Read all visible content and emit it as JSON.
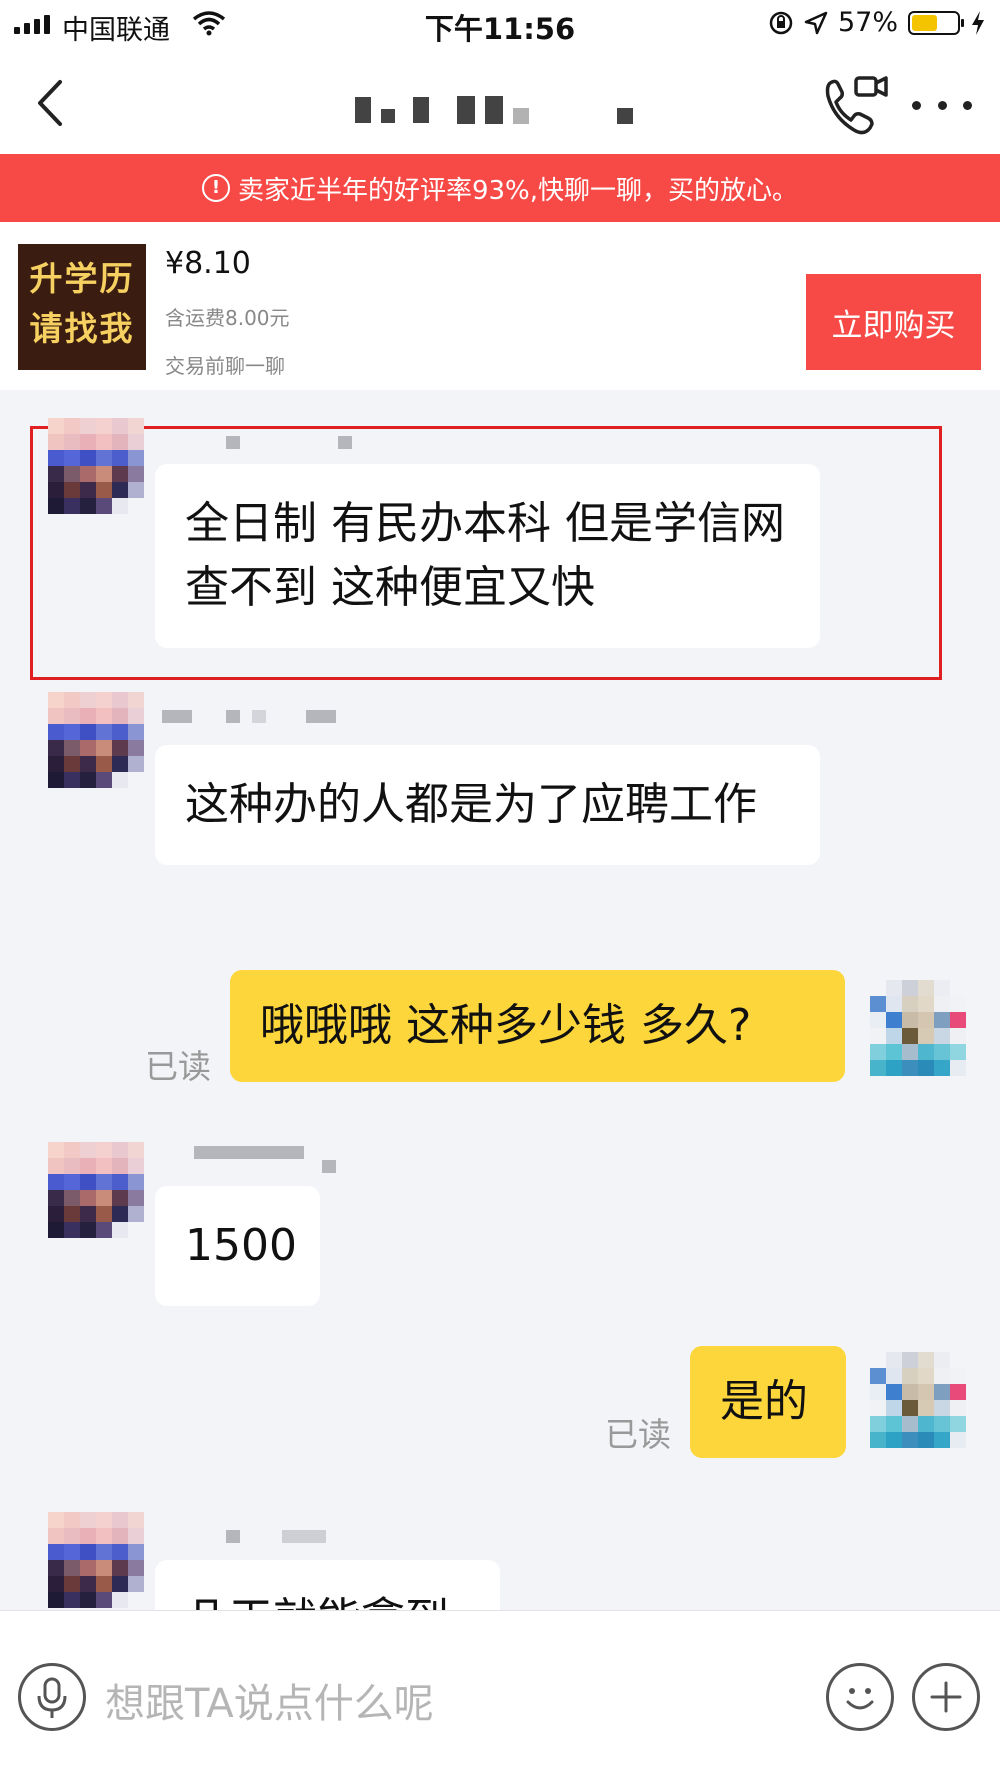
{
  "status_bar": {
    "carrier": "中国联通",
    "time": "下午11:56",
    "battery": "57%",
    "battery_level": 0.57
  },
  "header": {
    "back_icon": "chevron-left-icon",
    "call_icon": "video-call-icon",
    "more_icon": "more-dots-icon"
  },
  "notice": {
    "icon": "alert-circle-icon",
    "icon_glyph": "!",
    "text": "卖家近半年的好评率93%,快聊一聊，买的放心。"
  },
  "product": {
    "thumb_line1": "升学历",
    "thumb_line2": "请找我",
    "price": "¥8.10",
    "shipping": "含运费8.00元",
    "prompt": "交易前聊一聊",
    "buy_label": "立即购买"
  },
  "messages": [
    {
      "side": "in",
      "text": "全日制 有民办本科 但是学信网查不到 这种便宜又快",
      "highlighted": true
    },
    {
      "side": "in",
      "text": "这种办的人都是为了应聘工作"
    },
    {
      "side": "out",
      "text": "哦哦哦 这种多少钱 多久?",
      "read": "已读"
    },
    {
      "side": "in",
      "text": "1500"
    },
    {
      "side": "out",
      "text": "是的",
      "read": "已读"
    },
    {
      "side": "in",
      "text": "几天就能拿到"
    }
  ],
  "input": {
    "placeholder": "想跟TA说点什么呢",
    "mic_icon": "microphone-icon",
    "emoji_icon": "smiley-icon",
    "plus_icon": "plus-circle-icon"
  },
  "colors": {
    "accent_red": "#f74a47",
    "out_bubble": "#fcd63b",
    "highlight_border": "#e02020"
  }
}
